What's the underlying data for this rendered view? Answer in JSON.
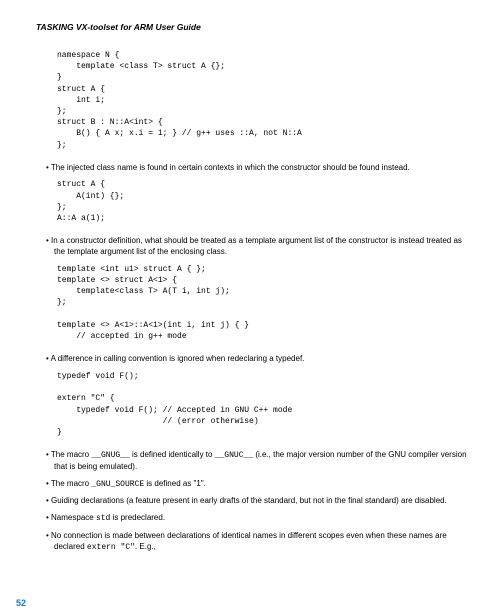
{
  "title": "TASKING VX-toolset for ARM User Guide",
  "code1": "namespace N {\n    template <class T> struct A {};\n}\nstruct A {\n    int i;\n};\nstruct B : N::A<int> {\n    B() { A x; x.i = 1; } // g++ uses ::A, not N::A\n};",
  "bullet1": "The injected class name is found in certain contexts in which the constructor should be found instead.",
  "code2": "struct A {\n    A(int) {};\n};\nA::A a(1);",
  "bullet2": "In a constructor definition, what should be treated as a template argument list of the constructor is instead treated as the template argument list of the enclosing class.",
  "code3": "template <int u1> struct A { };\ntemplate <> struct A<1> {\n    template<class T> A(T i, int j);\n};\n\ntemplate <> A<1>::A<1>(int i, int j) { }\n    // accepted in g++ mode",
  "bullet3": "A difference in calling convention is ignored when redeclaring a typedef.",
  "code4": "typedef void F();\n\nextern \"C\" {\n    typedef void F(); // Accepted in GNU C++ mode\n                      // (error otherwise)\n}",
  "bullet4_pre": "The macro ",
  "bullet4_m1": "__GNUG__",
  "bullet4_mid": " is defined identically to ",
  "bullet4_m2": "__GNUC__",
  "bullet4_post": " (i.e., the major version number of the GNU compiler version that is being emulated).",
  "bullet5_pre": "The macro ",
  "bullet5_m": "_GNU_SOURCE",
  "bullet5_post": " is defined as \"1\".",
  "bullet6": "Guiding declarations (a feature present in early drafts of the standard, but not in the final standard) are disabled.",
  "bullet7_pre": "Namespace ",
  "bullet7_m": "std",
  "bullet7_post": " is predeclared.",
  "bullet8_pre": "No connection is made between declarations of identical names in different scopes even when these names are declared ",
  "bullet8_m": "extern \"C\"",
  "bullet8_post": ". E.g.,",
  "pagenum": "52"
}
